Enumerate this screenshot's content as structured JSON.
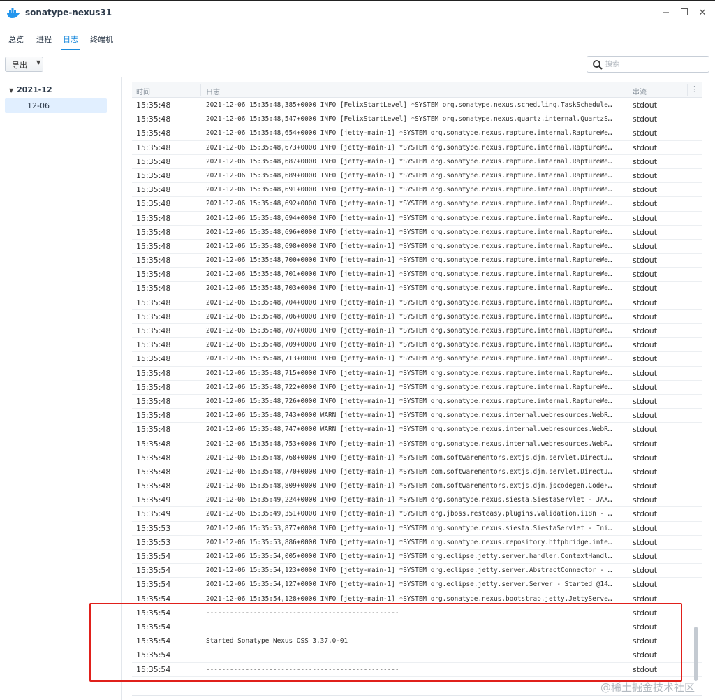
{
  "window": {
    "title": "sonatype-nexus31",
    "minimize": "−",
    "restore": "❐",
    "close": "✕"
  },
  "tabs": [
    {
      "label": "总览",
      "active": false
    },
    {
      "label": "进程",
      "active": false
    },
    {
      "label": "日志",
      "active": true
    },
    {
      "label": "终端机",
      "active": false
    }
  ],
  "toolbar": {
    "export_label": "导出",
    "search_placeholder": "搜索",
    "search_value": ""
  },
  "sidebar": {
    "year": "2021-12",
    "day": "12-06"
  },
  "grid": {
    "headers": {
      "time": "时间",
      "log": "日志",
      "stream": "串流"
    },
    "rows": [
      {
        "time": "15:35:48",
        "log": "2021-12-06 15:35:48,385+0000 INFO  [FelixStartLevel] *SYSTEM org.sonatype.nexus.scheduling.TaskSchedule…",
        "stream": "stdout"
      },
      {
        "time": "15:35:48",
        "log": "2021-12-06 15:35:48,547+0000 INFO  [FelixStartLevel] *SYSTEM org.sonatype.nexus.quartz.internal.QuartzS…",
        "stream": "stdout"
      },
      {
        "time": "15:35:48",
        "log": "2021-12-06 15:35:48,654+0000 INFO  [jetty-main-1] *SYSTEM org.sonatype.nexus.rapture.internal.RaptureWe…",
        "stream": "stdout"
      },
      {
        "time": "15:35:48",
        "log": "2021-12-06 15:35:48,673+0000 INFO  [jetty-main-1] *SYSTEM org.sonatype.nexus.rapture.internal.RaptureWe…",
        "stream": "stdout"
      },
      {
        "time": "15:35:48",
        "log": "2021-12-06 15:35:48,687+0000 INFO  [jetty-main-1] *SYSTEM org.sonatype.nexus.rapture.internal.RaptureWe…",
        "stream": "stdout"
      },
      {
        "time": "15:35:48",
        "log": "2021-12-06 15:35:48,689+0000 INFO  [jetty-main-1] *SYSTEM org.sonatype.nexus.rapture.internal.RaptureWe…",
        "stream": "stdout"
      },
      {
        "time": "15:35:48",
        "log": "2021-12-06 15:35:48,691+0000 INFO  [jetty-main-1] *SYSTEM org.sonatype.nexus.rapture.internal.RaptureWe…",
        "stream": "stdout"
      },
      {
        "time": "15:35:48",
        "log": "2021-12-06 15:35:48,692+0000 INFO  [jetty-main-1] *SYSTEM org.sonatype.nexus.rapture.internal.RaptureWe…",
        "stream": "stdout"
      },
      {
        "time": "15:35:48",
        "log": "2021-12-06 15:35:48,694+0000 INFO  [jetty-main-1] *SYSTEM org.sonatype.nexus.rapture.internal.RaptureWe…",
        "stream": "stdout"
      },
      {
        "time": "15:35:48",
        "log": "2021-12-06 15:35:48,696+0000 INFO  [jetty-main-1] *SYSTEM org.sonatype.nexus.rapture.internal.RaptureWe…",
        "stream": "stdout"
      },
      {
        "time": "15:35:48",
        "log": "2021-12-06 15:35:48,698+0000 INFO  [jetty-main-1] *SYSTEM org.sonatype.nexus.rapture.internal.RaptureWe…",
        "stream": "stdout"
      },
      {
        "time": "15:35:48",
        "log": "2021-12-06 15:35:48,700+0000 INFO  [jetty-main-1] *SYSTEM org.sonatype.nexus.rapture.internal.RaptureWe…",
        "stream": "stdout"
      },
      {
        "time": "15:35:48",
        "log": "2021-12-06 15:35:48,701+0000 INFO  [jetty-main-1] *SYSTEM org.sonatype.nexus.rapture.internal.RaptureWe…",
        "stream": "stdout"
      },
      {
        "time": "15:35:48",
        "log": "2021-12-06 15:35:48,703+0000 INFO  [jetty-main-1] *SYSTEM org.sonatype.nexus.rapture.internal.RaptureWe…",
        "stream": "stdout"
      },
      {
        "time": "15:35:48",
        "log": "2021-12-06 15:35:48,704+0000 INFO  [jetty-main-1] *SYSTEM org.sonatype.nexus.rapture.internal.RaptureWe…",
        "stream": "stdout"
      },
      {
        "time": "15:35:48",
        "log": "2021-12-06 15:35:48,706+0000 INFO  [jetty-main-1] *SYSTEM org.sonatype.nexus.rapture.internal.RaptureWe…",
        "stream": "stdout"
      },
      {
        "time": "15:35:48",
        "log": "2021-12-06 15:35:48,707+0000 INFO  [jetty-main-1] *SYSTEM org.sonatype.nexus.rapture.internal.RaptureWe…",
        "stream": "stdout"
      },
      {
        "time": "15:35:48",
        "log": "2021-12-06 15:35:48,709+0000 INFO  [jetty-main-1] *SYSTEM org.sonatype.nexus.rapture.internal.RaptureWe…",
        "stream": "stdout"
      },
      {
        "time": "15:35:48",
        "log": "2021-12-06 15:35:48,713+0000 INFO  [jetty-main-1] *SYSTEM org.sonatype.nexus.rapture.internal.RaptureWe…",
        "stream": "stdout"
      },
      {
        "time": "15:35:48",
        "log": "2021-12-06 15:35:48,715+0000 INFO  [jetty-main-1] *SYSTEM org.sonatype.nexus.rapture.internal.RaptureWe…",
        "stream": "stdout"
      },
      {
        "time": "15:35:48",
        "log": "2021-12-06 15:35:48,722+0000 INFO  [jetty-main-1] *SYSTEM org.sonatype.nexus.rapture.internal.RaptureWe…",
        "stream": "stdout"
      },
      {
        "time": "15:35:48",
        "log": "2021-12-06 15:35:48,726+0000 INFO  [jetty-main-1] *SYSTEM org.sonatype.nexus.rapture.internal.RaptureWe…",
        "stream": "stdout"
      },
      {
        "time": "15:35:48",
        "log": "2021-12-06 15:35:48,743+0000 WARN  [jetty-main-1] *SYSTEM org.sonatype.nexus.internal.webresources.WebR…",
        "stream": "stdout"
      },
      {
        "time": "15:35:48",
        "log": "2021-12-06 15:35:48,747+0000 WARN  [jetty-main-1] *SYSTEM org.sonatype.nexus.internal.webresources.WebR…",
        "stream": "stdout"
      },
      {
        "time": "15:35:48",
        "log": "2021-12-06 15:35:48,753+0000 INFO  [jetty-main-1] *SYSTEM org.sonatype.nexus.internal.webresources.WebR…",
        "stream": "stdout"
      },
      {
        "time": "15:35:48",
        "log": "2021-12-06 15:35:48,768+0000 INFO  [jetty-main-1] *SYSTEM com.softwarementors.extjs.djn.servlet.DirectJ…",
        "stream": "stdout"
      },
      {
        "time": "15:35:48",
        "log": "2021-12-06 15:35:48,770+0000 INFO  [jetty-main-1] *SYSTEM com.softwarementors.extjs.djn.servlet.DirectJ…",
        "stream": "stdout"
      },
      {
        "time": "15:35:48",
        "log": "2021-12-06 15:35:48,809+0000 INFO  [jetty-main-1] *SYSTEM com.softwarementors.extjs.djn.jscodegen.CodeF…",
        "stream": "stdout"
      },
      {
        "time": "15:35:49",
        "log": "2021-12-06 15:35:49,224+0000 INFO  [jetty-main-1] *SYSTEM org.sonatype.nexus.siesta.SiestaServlet - JAX…",
        "stream": "stdout"
      },
      {
        "time": "15:35:49",
        "log": "2021-12-06 15:35:49,351+0000 INFO  [jetty-main-1] *SYSTEM org.jboss.resteasy.plugins.validation.i18n - …",
        "stream": "stdout"
      },
      {
        "time": "15:35:53",
        "log": "2021-12-06 15:35:53,877+0000 INFO  [jetty-main-1] *SYSTEM org.sonatype.nexus.siesta.SiestaServlet - Ini…",
        "stream": "stdout"
      },
      {
        "time": "15:35:53",
        "log": "2021-12-06 15:35:53,886+0000 INFO  [jetty-main-1] *SYSTEM org.sonatype.nexus.repository.httpbridge.inte…",
        "stream": "stdout"
      },
      {
        "time": "15:35:54",
        "log": "2021-12-06 15:35:54,005+0000 INFO  [jetty-main-1] *SYSTEM org.eclipse.jetty.server.handler.ContextHandl…",
        "stream": "stdout"
      },
      {
        "time": "15:35:54",
        "log": "2021-12-06 15:35:54,123+0000 INFO  [jetty-main-1] *SYSTEM org.eclipse.jetty.server.AbstractConnector - …",
        "stream": "stdout"
      },
      {
        "time": "15:35:54",
        "log": "2021-12-06 15:35:54,127+0000 INFO  [jetty-main-1] *SYSTEM org.eclipse.jetty.server.Server - Started @14…",
        "stream": "stdout"
      },
      {
        "time": "15:35:54",
        "log": "2021-12-06 15:35:54,128+0000 INFO  [jetty-main-1] *SYSTEM org.sonatype.nexus.bootstrap.jetty.JettyServe…",
        "stream": "stdout"
      },
      {
        "time": "15:35:54",
        "log": "-------------------------------------------------",
        "stream": "stdout"
      },
      {
        "time": "15:35:54",
        "log": "",
        "stream": "stdout"
      },
      {
        "time": "15:35:54",
        "log": "Started Sonatype Nexus OSS 3.37.0-01",
        "stream": "stdout"
      },
      {
        "time": "15:35:54",
        "log": "",
        "stream": "stdout"
      },
      {
        "time": "15:35:54",
        "log": "-------------------------------------------------",
        "stream": "stdout"
      }
    ]
  },
  "watermark": "@稀土掘金技术社区",
  "colors": {
    "accent": "#1a8adc",
    "highlight": "#e0201b",
    "selected_bg": "#e1efff"
  }
}
